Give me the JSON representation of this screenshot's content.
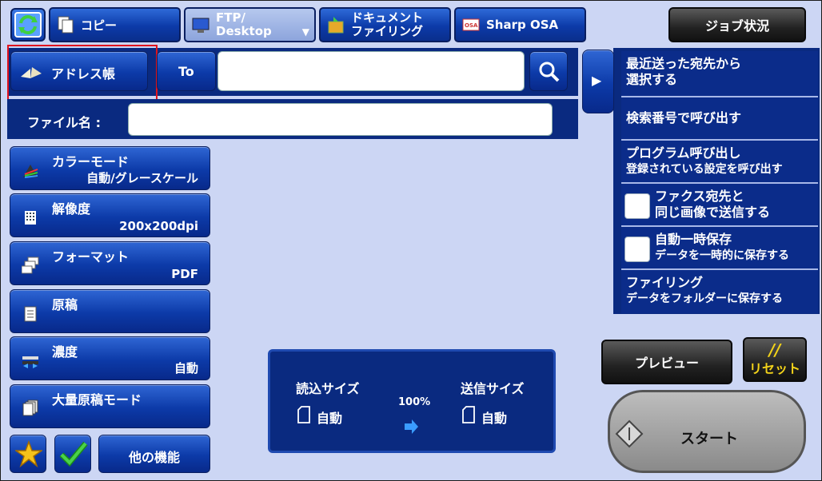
{
  "tabs": [
    {
      "label": "コピー"
    },
    {
      "label_line1": "FTP/",
      "label_line2": "Desktop"
    },
    {
      "label_line1": "ドキュメント",
      "label_line2": "ファイリング"
    },
    {
      "label": "Sharp OSA"
    }
  ],
  "job_status": "ジョブ状況",
  "address": {
    "address_book": "アドレス帳",
    "to_label": "To",
    "to_value": "",
    "file_name_label": "ファイル名 :",
    "file_name_value": ""
  },
  "settings": [
    {
      "title": "カラーモード",
      "value": "自動/グレースケール"
    },
    {
      "title": "解像度",
      "value": "200x200dpi"
    },
    {
      "title": "フォーマット",
      "value": "PDF"
    },
    {
      "title": "原稿",
      "value": ""
    },
    {
      "title": "濃度",
      "value": "自動"
    },
    {
      "title": "大量原稿モード",
      "value": ""
    }
  ],
  "other_functions": "他の機能",
  "side_panel": {
    "recent_line1": "最近送った宛先から",
    "recent_line2": "選択する",
    "search_number": "検索番号で呼び出す",
    "program_line1": "プログラム呼び出し",
    "program_line2": "登録されている設定を呼び出す",
    "fax_line1": "ファクス宛先と",
    "fax_line2": "同じ画像で送信する",
    "autosave_line1": "自動一時保存",
    "autosave_line2": "データを一時的に保存する",
    "filing_line1": "ファイリング",
    "filing_line2": "データをフォルダーに保存する"
  },
  "scan_info": {
    "scan_size_label": "読込サイズ",
    "scan_size_value": "自動",
    "ratio": "100%",
    "send_size_label": "送信サイズ",
    "send_size_value": "自動"
  },
  "preview": "プレビュー",
  "reset": "リセット",
  "start": "スタート",
  "colors": {
    "navy": "#0a2a80",
    "highlight": "#e0141e",
    "reset_yellow": "#f2d21a"
  }
}
